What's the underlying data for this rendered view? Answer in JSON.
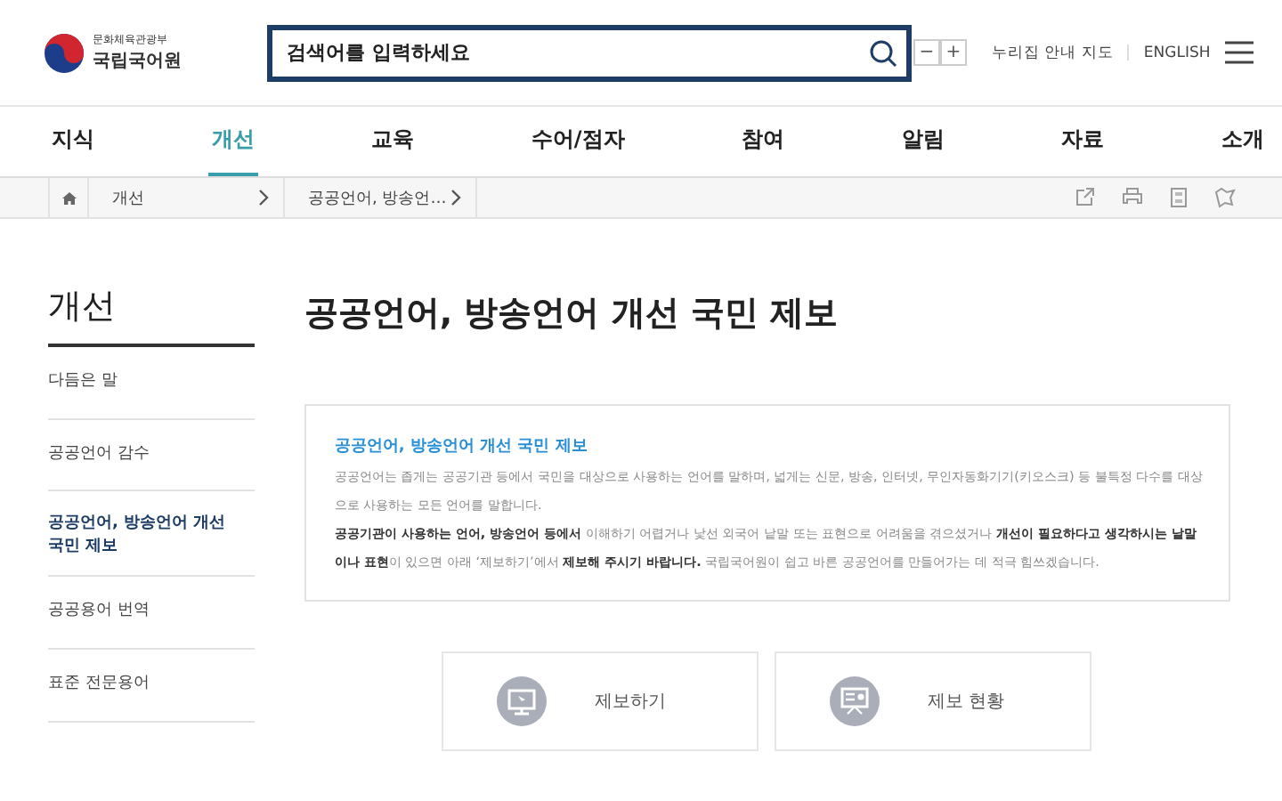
{
  "logo": {
    "ministry": "문화체육관광부",
    "name": "국립국어원"
  },
  "search": {
    "placeholder": "검색어를 입력하세요"
  },
  "zoom_buttons": [
    "−",
    "+"
  ],
  "header_links": [
    "누리집 안내 지도",
    "ENGLISH"
  ],
  "nav": [
    {
      "label": "지식",
      "selected": false
    },
    {
      "label": "개선",
      "selected": true
    },
    {
      "label": "교육",
      "selected": false
    },
    {
      "label": "수어/점자",
      "selected": false
    },
    {
      "label": "참여",
      "selected": false
    },
    {
      "label": "알림",
      "selected": false
    },
    {
      "label": "자료",
      "selected": false
    },
    {
      "label": "소개",
      "selected": false
    }
  ],
  "breadcrumb": [
    "개선",
    "공공언어, 방송언…"
  ],
  "sidebar": {
    "title": "개선",
    "items": [
      {
        "label": "다듬은 말",
        "selected": false
      },
      {
        "label": "공공언어 감수",
        "selected": false
      },
      {
        "label": "공공언어, 방송언어 개선 국민 제보",
        "selected": true
      },
      {
        "label": "공공용어 번역",
        "selected": false
      },
      {
        "label": "표준 전문용어",
        "selected": false
      }
    ]
  },
  "page_title": "공공언어, 방송언어 개선 국민 제보",
  "intro": {
    "heading": "공공언어, 방송언어 개선 국민 제보",
    "paragraphs": [
      "공공언어는 좁게는 공공기관 등에서 국민을 대상으로 사용하는 언어를 말하며, 넓게는 신문, 방송, 인터넷, 무인자동화기기(키오스크) 등 불특정 다수를 대상으로 사용하는 모든 언어를 말합니다.",
      "**공공기관이 사용하는 언어, 방송언어 등에서** 이해하기 어렵거나 낯선 외국어 낱말 또는 표현으로 어려움을 겪으셨거나 **개선이 필요하다고 생각하시는 낱말이나 표현**이 있으면 아래 ‘제보하기’에서 **제보해 주시기 바랍니다.** 국립국어원이 쉽고 바른 공공언어를 만들어가는 데 적극 힘쓰겠습니다."
    ]
  },
  "actions": [
    {
      "kind": "monitor",
      "label": "제보하기"
    },
    {
      "kind": "board",
      "label": "제보 현황"
    }
  ]
}
